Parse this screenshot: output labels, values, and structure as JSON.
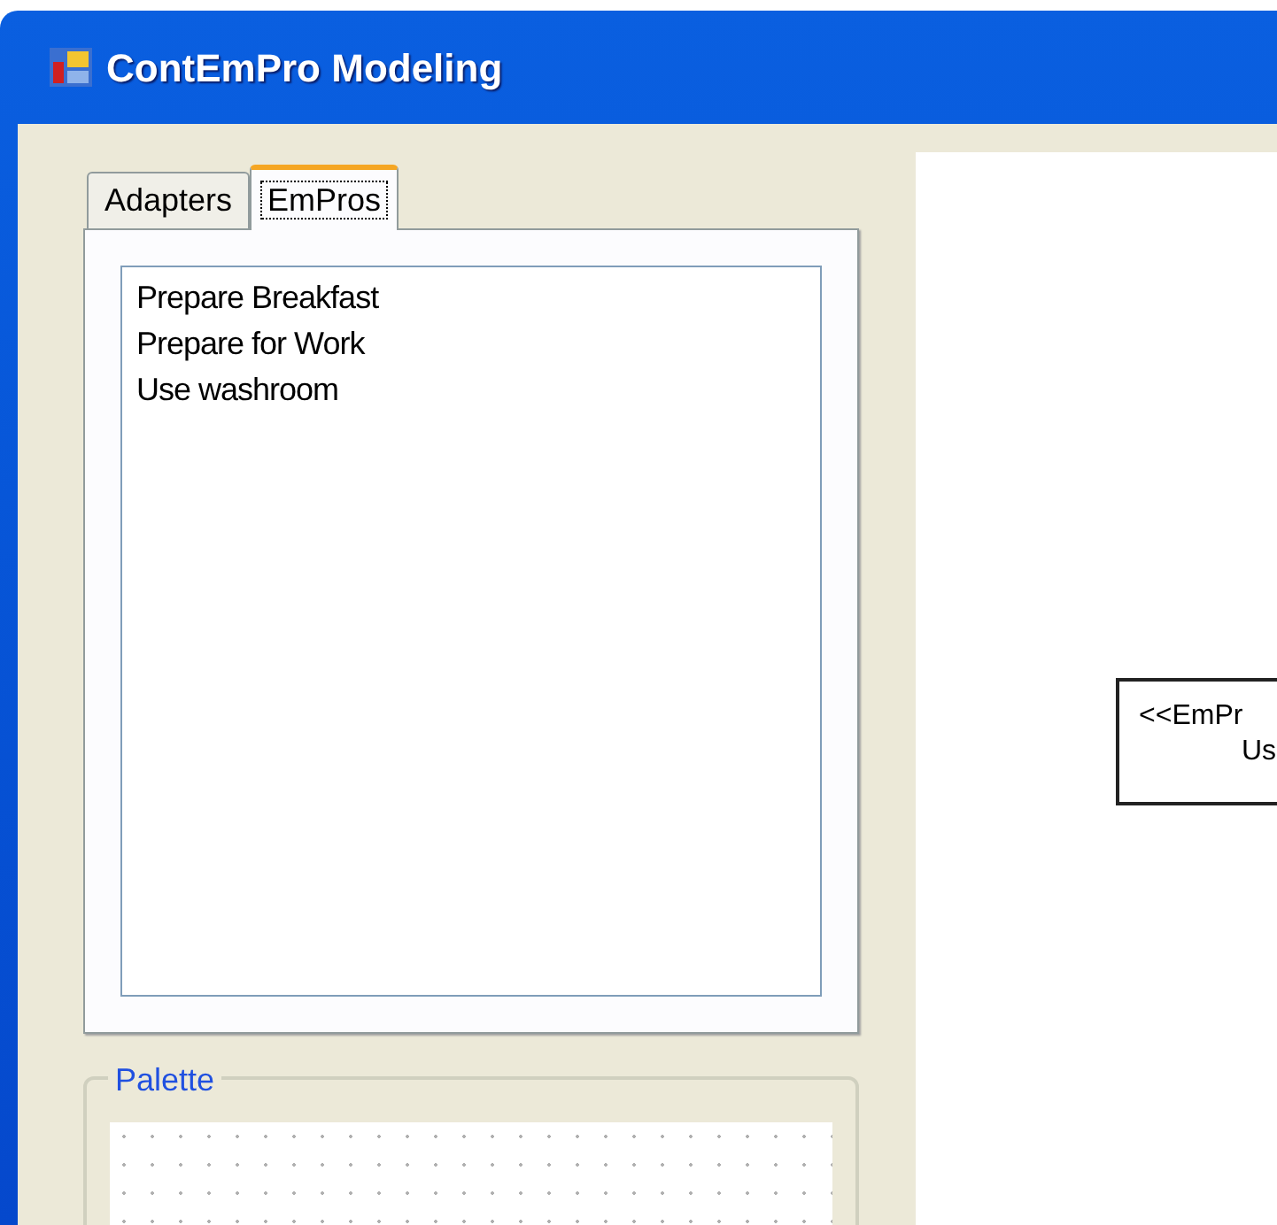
{
  "window": {
    "title": "ContEmPro Modeling"
  },
  "tabs": [
    {
      "label": "Adapters",
      "selected": false
    },
    {
      "label": "EmPros",
      "selected": true
    }
  ],
  "list": {
    "items": [
      "Prepare Breakfast",
      "Prepare for Work",
      "Use washroom"
    ]
  },
  "palette": {
    "title": "Palette"
  },
  "diagram": {
    "node": {
      "lines": [
        "<<EmPr",
        "Us"
      ]
    }
  }
}
